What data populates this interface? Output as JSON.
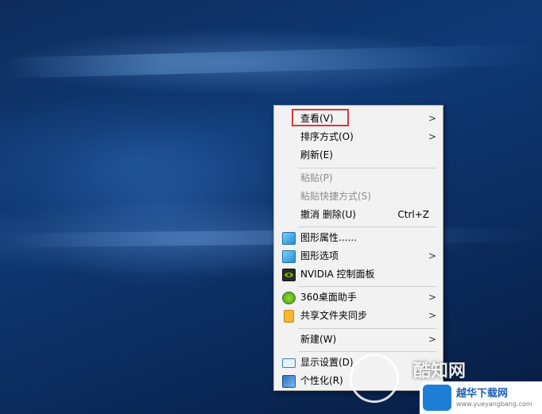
{
  "context_menu": {
    "items": [
      {
        "label": "查看(V)",
        "submenu": true,
        "highlighted": true
      },
      {
        "label": "排序方式(O)",
        "submenu": true
      },
      {
        "label": "刷新(E)"
      },
      {
        "label": "粘贴(P)",
        "disabled": true
      },
      {
        "label": "粘贴快捷方式(S)",
        "disabled": true
      },
      {
        "label": "撤消 删除(U)",
        "shortcut": "Ctrl+Z"
      },
      {
        "label": "图形属性......",
        "icon": "intel-graphics-icon"
      },
      {
        "label": "图形选项",
        "icon": "intel-graphics-icon",
        "submenu": true
      },
      {
        "label": "NVIDIA 控制面板",
        "icon": "nvidia-icon"
      },
      {
        "label": "360桌面助手",
        "icon": "360-icon",
        "submenu": true
      },
      {
        "label": "共享文件夹同步",
        "icon": "share-sync-icon",
        "submenu": true
      },
      {
        "label": "新建(W)",
        "submenu": true
      },
      {
        "label": "显示设置(D)",
        "icon": "display-icon"
      },
      {
        "label": "个性化(R)",
        "icon": "personalize-icon"
      }
    ],
    "submenu_glyph": ">"
  },
  "watermark": {
    "brand_text": "酷知网",
    "site_name": "越华下载网",
    "site_url": "www.yueyangbang.com"
  },
  "colors": {
    "highlight_box": "#d9363e",
    "menu_bg": "#f2f2f2",
    "desktop_bg": "#0f3a75"
  }
}
